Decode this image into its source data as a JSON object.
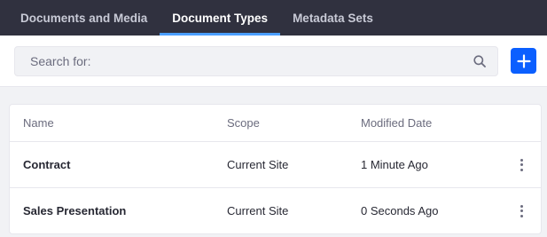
{
  "nav": {
    "tabs": [
      {
        "label": "Documents and Media"
      },
      {
        "label": "Document Types"
      },
      {
        "label": "Metadata Sets"
      }
    ]
  },
  "toolbar": {
    "search_placeholder": "Search for:",
    "add_icon": "plus-icon",
    "search_icon": "search-icon"
  },
  "table": {
    "columns": [
      "Name",
      "Scope",
      "Modified Date"
    ],
    "rows": [
      {
        "name": "Contract",
        "scope": "Current Site",
        "modified": "1 Minute Ago"
      },
      {
        "name": "Sales Presentation",
        "scope": "Current Site",
        "modified": "0 Seconds Ago"
      }
    ]
  },
  "colors": {
    "navbar": "#30313f",
    "active_tab_indicator": "#4b9fff",
    "primary": "#0b5fff"
  }
}
